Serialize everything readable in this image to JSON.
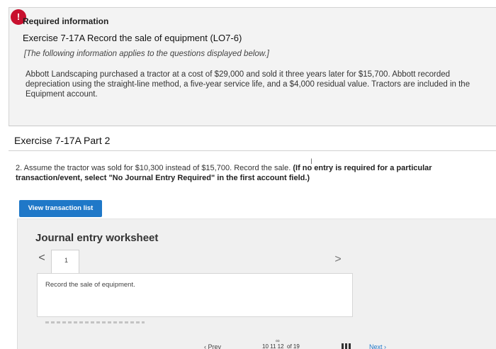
{
  "required_info": {
    "alert_glyph": "!",
    "label": "Required information",
    "exercise_title": "Exercise 7-17A Record the sale of equipment (LO7-6)",
    "intro": "[The following information applies to the questions displayed below.]",
    "body": "Abbott Landscaping purchased a tractor at a cost of $29,000 and sold it three years later for $15,700. Abbott recorded depreciation using the straight-line method, a five-year service life, and a $4,000 residual value. Tractors are included in the Equipment account."
  },
  "part": {
    "title": "Exercise 7-17A Part 2",
    "question_text": "2. Assume the tractor was sold for $10,300 instead of $15,700. Record the sale. ",
    "question_bold": "(If no entry is required for a particular transaction/event, select \"No Journal Entry Required\" in the first account field.)"
  },
  "buttons": {
    "view_transaction_list": "View transaction list"
  },
  "worksheet": {
    "title": "Journal entry worksheet",
    "prev_glyph": "<",
    "next_glyph": ">",
    "tab_number": "1",
    "entry_description": "Record the sale of equipment."
  },
  "pagination": {
    "prev_label": "Prev",
    "page_numbers": "10   11   12",
    "of_label": "of 19",
    "next_label": "Next"
  },
  "colors": {
    "accent": "#1f78c8",
    "alert": "#c8102e"
  }
}
